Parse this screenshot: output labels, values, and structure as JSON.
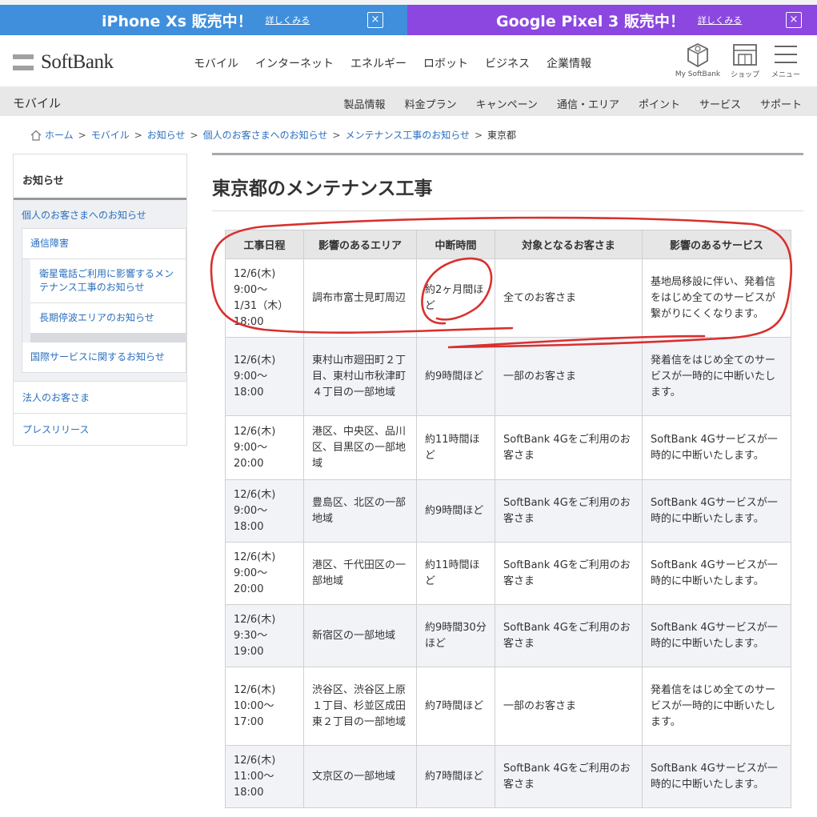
{
  "promo": {
    "left": {
      "title": "iPhone Xs 販売中！",
      "more": "詳しくみる",
      "close": "×"
    },
    "right": {
      "title": "Google Pixel 3 販売中！",
      "more": "詳しくみる",
      "close": "×"
    }
  },
  "header": {
    "logo": "SoftBank",
    "nav": [
      "モバイル",
      "インターネット",
      "エネルギー",
      "ロボット",
      "ビジネス",
      "企業情報"
    ],
    "icons": [
      {
        "name": "my-softbank-icon",
        "label": "My SoftBank"
      },
      {
        "name": "shop-icon",
        "label": "ショップ"
      },
      {
        "name": "menu-icon",
        "label": "メニュー"
      }
    ]
  },
  "subnav": {
    "title": "モバイル",
    "links": [
      "製品情報",
      "料金プラン",
      "キャンペーン",
      "通信・エリア",
      "ポイント",
      "サービス",
      "サポート"
    ]
  },
  "breadcrumb": [
    "ホーム",
    "モバイル",
    "お知らせ",
    "個人のお客さまへのお知らせ",
    "メンテナンス工事のお知らせ",
    "東京都"
  ],
  "sidebar": {
    "heading": "お知らせ",
    "section": "個人のお客さまへのお知らせ",
    "item_outage": "通信障害",
    "sub_items": [
      "衛星電話ご利用に影響するメンテナンス工事のお知らせ",
      "長期停波エリアのお知らせ"
    ],
    "item_intl": "国際サービスに関するお知らせ",
    "corporate": "法人のお客さま",
    "press": "プレスリリース"
  },
  "page_title": "東京都のメンテナンス工事",
  "table": {
    "headers": [
      "工事日程",
      "影響のあるエリア",
      "中断時間",
      "対象となるお客さま",
      "影響のあるサービス"
    ],
    "rows": [
      {
        "date": "12/6(木)\n9:00〜\n1/31（木）\n18:00",
        "area": "調布市富士見町周辺",
        "duration": "約2ヶ月間ほど",
        "target": "全てのお客さま",
        "service": "基地局移設に伴い、発着信をはじめ全てのサービスが繋がりにくくなります。"
      },
      {
        "date": "12/6(木)\n9:00〜\n18:00",
        "area": "東村山市廻田町２丁目、東村山市秋津町４丁目の一部地域",
        "duration": "約9時間ほど",
        "target": "一部のお客さま",
        "service": "発着信をはじめ全てのサービスが一時的に中断いたします。"
      },
      {
        "date": "12/6(木)\n9:00〜\n20:00",
        "area": "港区、中央区、品川区、目黒区の一部地域",
        "duration": "約11時間ほど",
        "target": "SoftBank 4Gをご利用のお客さま",
        "service": "SoftBank 4Gサービスが一時的に中断いたします。"
      },
      {
        "date": "12/6(木)\n9:00〜\n18:00",
        "area": "豊島区、北区の一部地域",
        "duration": "約9時間ほど",
        "target": "SoftBank 4Gをご利用のお客さま",
        "service": "SoftBank 4Gサービスが一時的に中断いたします。"
      },
      {
        "date": "12/6(木)\n9:00〜\n20:00",
        "area": "港区、千代田区の一部地域",
        "duration": "約11時間ほど",
        "target": "SoftBank 4Gをご利用のお客さま",
        "service": "SoftBank 4Gサービスが一時的に中断いたします。"
      },
      {
        "date": "12/6(木)\n9:30〜\n19:00",
        "area": "新宿区の一部地域",
        "duration": "約9時間30分ほど",
        "target": "SoftBank 4Gをご利用のお客さま",
        "service": "SoftBank 4Gサービスが一時的に中断いたします。"
      },
      {
        "date": "12/6(木)\n10:00〜\n17:00",
        "area": "渋谷区、渋谷区上原１丁目、杉並区成田東２丁目の一部地域",
        "duration": "約7時間ほど",
        "target": "一部のお客さま",
        "service": "発着信をはじめ全てのサービスが一時的に中断いたします。"
      },
      {
        "date": "12/6(木)\n11:00〜\n18:00",
        "area": "文京区の一部地域",
        "duration": "約7時間ほど",
        "target": "SoftBank 4Gをご利用のお客さま",
        "service": "SoftBank 4Gサービスが一時的に中断いたします。"
      }
    ]
  },
  "colors": {
    "promo_left": "#3f8fdc",
    "promo_right": "#8b47e0",
    "link": "#2a6fbf",
    "annotation": "#d8302f"
  }
}
